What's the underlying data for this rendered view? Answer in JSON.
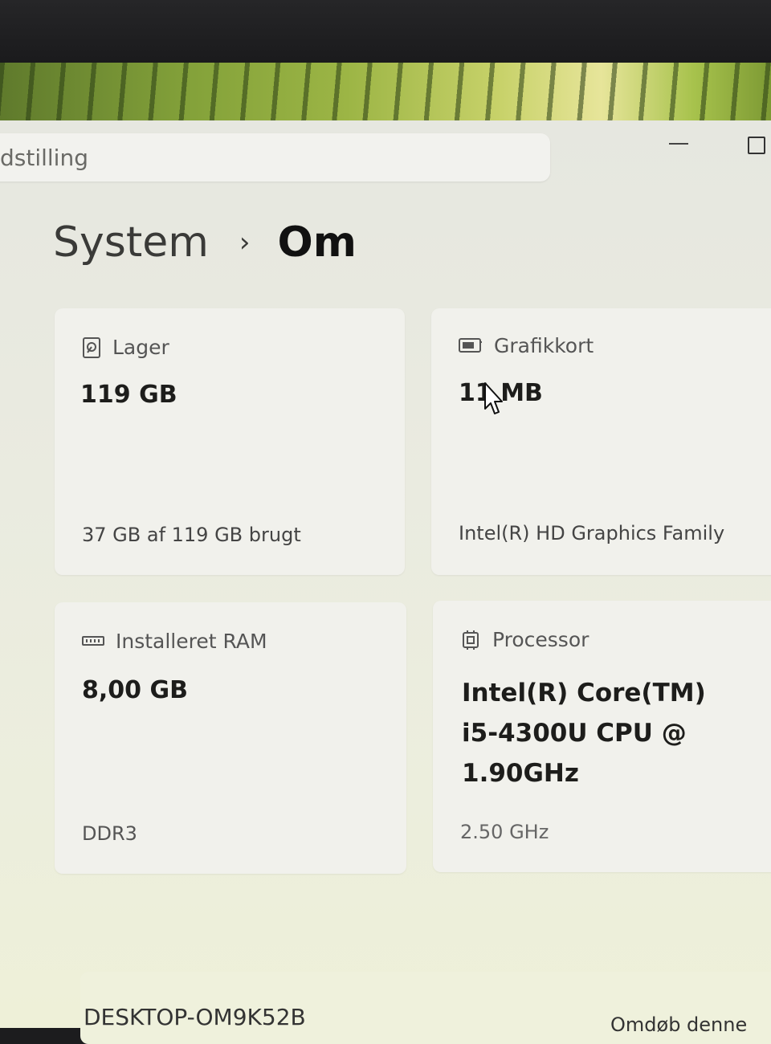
{
  "search": {
    "placeholder": "dstilling"
  },
  "breadcrumb": {
    "parent": "System",
    "separator": "›",
    "current": "Om"
  },
  "cards": {
    "storage": {
      "label": "Lager",
      "value": "119 GB",
      "detail": "37 GB af 119 GB brugt",
      "icon": "storage-icon"
    },
    "graphics": {
      "label": "Grafikkort",
      "value": "11 MB",
      "detail": "Intel(R) HD Graphics Family",
      "icon": "graphics-card-icon"
    },
    "ram": {
      "label": "Installeret RAM",
      "value": "8,00 GB",
      "detail": "DDR3",
      "icon": "memory-icon"
    },
    "processor": {
      "label": "Processor",
      "value": "Intel(R) Core(TM) i5-4300U CPU @ 1.90GHz",
      "detail": "2.50 GHz",
      "icon": "processor-icon"
    }
  },
  "device": {
    "name": "DESKTOP-OM9K52B",
    "rename_label": "Omdøb denne"
  }
}
